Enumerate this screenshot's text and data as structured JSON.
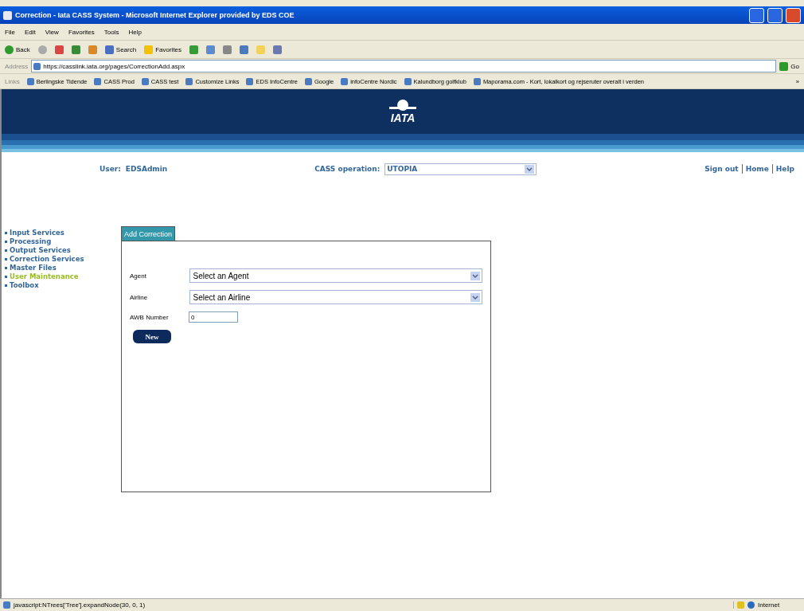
{
  "window": {
    "title": "Correction - Iata CASS System - Microsoft Internet Explorer provided by EDS COE"
  },
  "menu": [
    "File",
    "Edit",
    "View",
    "Favorites",
    "Tools",
    "Help"
  ],
  "toolbar": [
    {
      "kind": "back",
      "label": "Back"
    },
    {
      "kind": "forward"
    },
    {
      "kind": "stop"
    },
    {
      "kind": "refresh"
    },
    {
      "kind": "home"
    },
    {
      "kind": "search",
      "label": "Search"
    },
    {
      "kind": "favorites",
      "label": "Favorites"
    },
    {
      "kind": "history"
    },
    {
      "kind": "mail"
    },
    {
      "kind": "print"
    },
    {
      "kind": "edit"
    },
    {
      "kind": "note"
    },
    {
      "kind": "messenger"
    }
  ],
  "address": {
    "label": "Address",
    "url": "https://casslink.iata.org/pages/CorrectionAdd.aspx",
    "go": "Go"
  },
  "links": {
    "label": "Links",
    "items": [
      "Berlingske Tidende",
      "CASS Prod",
      "CASS test",
      "Customize Links",
      "EDS InfoCentre",
      "Google",
      "infoCentre Nordic",
      "Kalundborg golfklub",
      "Maporama.com - Kort, lokalkort og rejseruter overalt i verden"
    ],
    "more": "»"
  },
  "header": {
    "logo": "IATA"
  },
  "user": {
    "label": "User:",
    "value": "EDSAdmin"
  },
  "operation": {
    "label": "CASS operation:",
    "value": "UTOPIA"
  },
  "nav_links": [
    "Sign out",
    "Home",
    "Help"
  ],
  "sidebar": {
    "items": [
      {
        "label": "Input Services",
        "selected": false
      },
      {
        "label": "Processing",
        "selected": false
      },
      {
        "label": "Output Services",
        "selected": false
      },
      {
        "label": "Correction Services",
        "selected": false
      },
      {
        "label": "Master Files",
        "selected": false
      },
      {
        "label": "User Maintenance",
        "selected": true
      },
      {
        "label": "Toolbox",
        "selected": false
      }
    ]
  },
  "tabs": [
    {
      "label": "Add Correction",
      "selected": true
    }
  ],
  "form": {
    "fields": [
      {
        "kind": "select",
        "label": "Agent",
        "value": "Select an Agent"
      },
      {
        "kind": "select",
        "label": "Airline",
        "value": "Select an Airline"
      },
      {
        "kind": "text",
        "label": "AWB Number",
        "value": "0"
      }
    ],
    "button": "New"
  },
  "status_bar": {
    "text": "javascript:NTrees['Tree'].expandNode(30, 0, 1)",
    "zone": "Internet"
  }
}
